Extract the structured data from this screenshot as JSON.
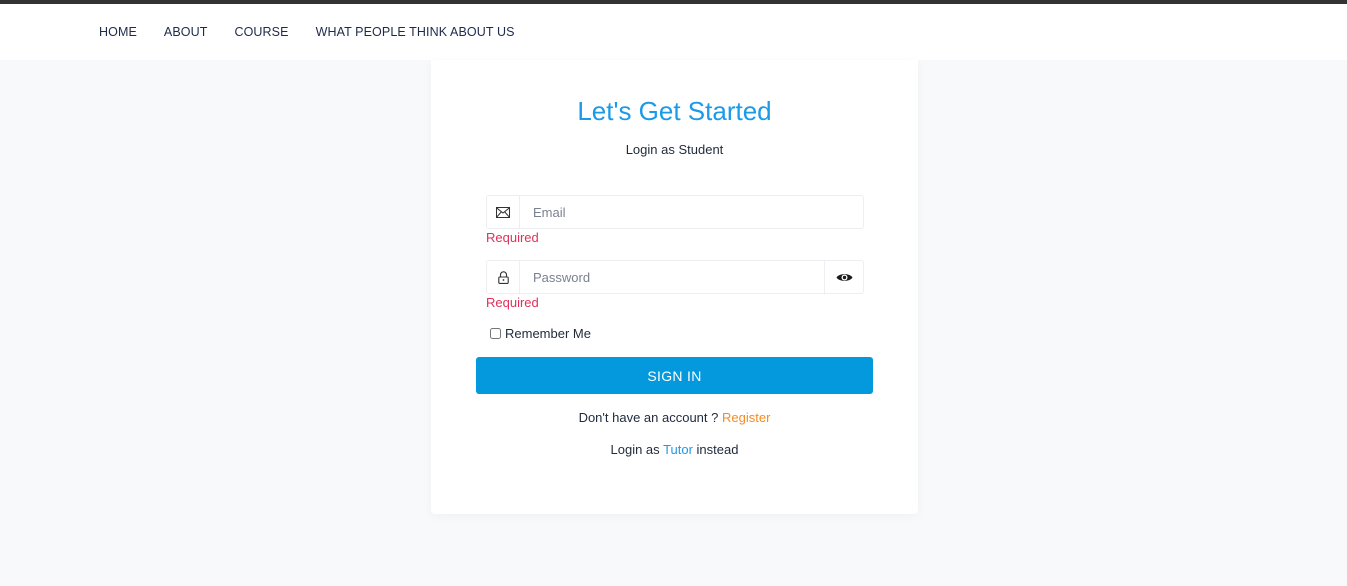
{
  "nav": {
    "items": [
      {
        "label": "HOME"
      },
      {
        "label": "ABOUT"
      },
      {
        "label": "COURSE"
      },
      {
        "label": "WHAT PEOPLE THINK ABOUT US"
      }
    ]
  },
  "login": {
    "title": "Let's Get Started",
    "subtitle": "Login as Student",
    "email": {
      "placeholder": "Email",
      "value": "",
      "icon": "envelope-icon",
      "error": "Required"
    },
    "password": {
      "placeholder": "Password",
      "value": "",
      "icon": "lock-icon",
      "toggle_icon": "eye-icon",
      "error": "Required"
    },
    "remember_label": "Remember Me",
    "remember_checked": false,
    "signin_label": "SIGN IN",
    "no_account_text": "Don't have an account ?",
    "register_link": "Register",
    "alt_login_prefix": "Login as",
    "alt_login_link": "Tutor",
    "alt_login_suffix": "instead"
  },
  "colors": {
    "accent": "#1b9ae8",
    "button": "#0399dc",
    "error": "#e0315a",
    "register_link": "#f68b1f",
    "topbar": "#333333",
    "background": "#f8f9fb"
  }
}
